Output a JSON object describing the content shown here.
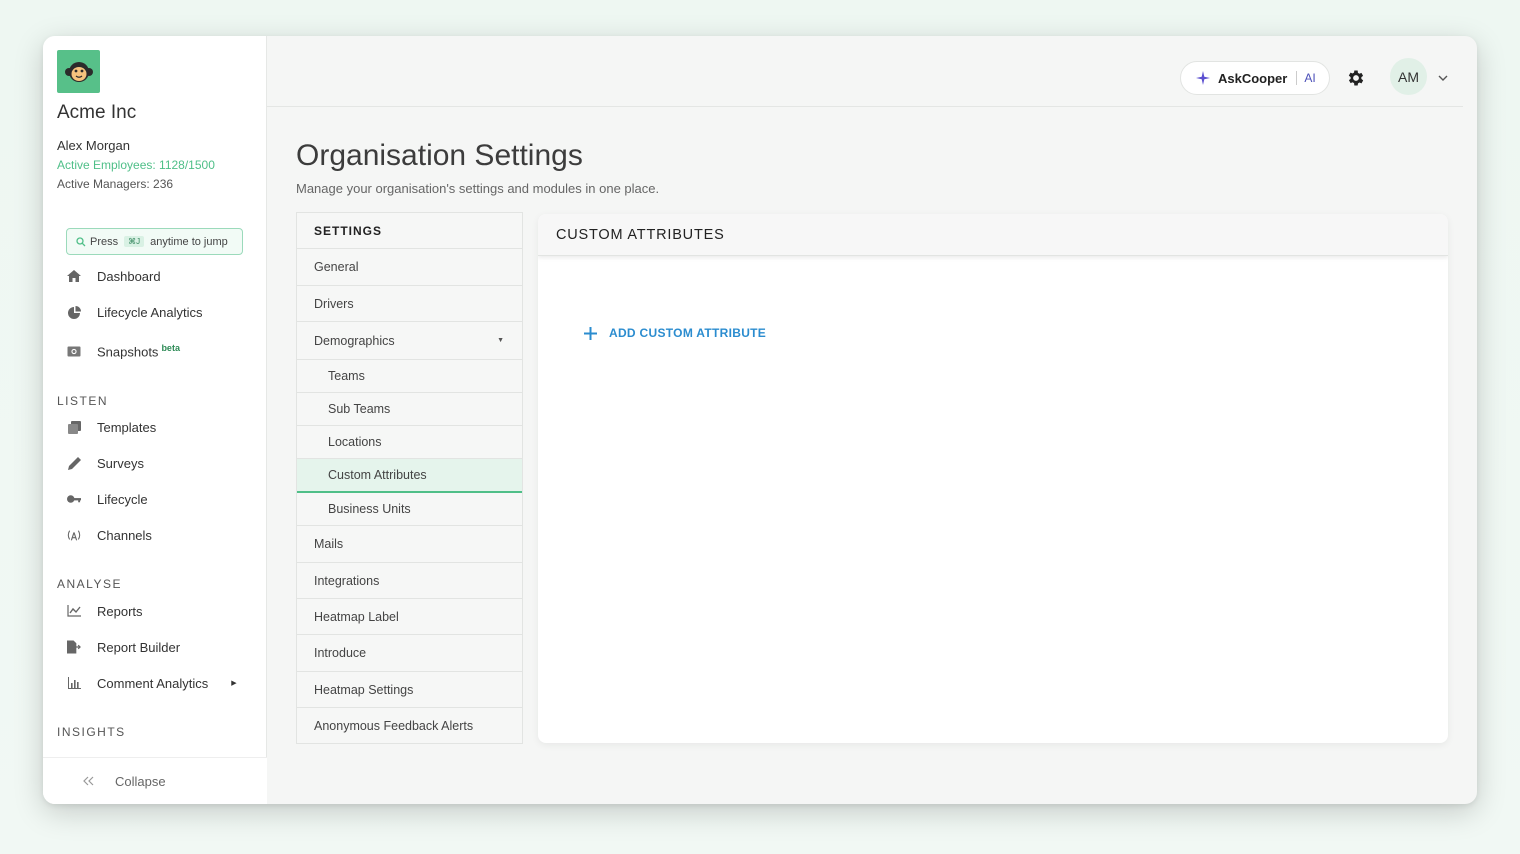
{
  "sidebar": {
    "org_name": "Acme Inc",
    "user_name": "Alex Morgan",
    "active_employees": "Active Employees: 1128/1500",
    "active_managers": "Active Managers: 236",
    "search": {
      "prefix": "Press",
      "shortcut": "⌘J",
      "suffix": "anytime to jump"
    },
    "main_items": [
      {
        "label": "Dashboard",
        "icon": "home-icon"
      },
      {
        "label": "Lifecycle Analytics",
        "icon": "pie-chart-icon"
      },
      {
        "label": "Snapshots",
        "icon": "camera-icon",
        "badge": "beta"
      }
    ],
    "listen_label": "LISTEN",
    "listen_items": [
      {
        "label": "Templates",
        "icon": "copy-icon"
      },
      {
        "label": "Surveys",
        "icon": "pen-icon"
      },
      {
        "label": "Lifecycle",
        "icon": "key-icon"
      },
      {
        "label": "Channels",
        "icon": "broadcast-icon"
      }
    ],
    "analyse_label": "ANALYSE",
    "analyse_items": [
      {
        "label": "Reports",
        "icon": "line-chart-icon"
      },
      {
        "label": "Report Builder",
        "icon": "document-arrow-icon"
      },
      {
        "label": "Comment Analytics",
        "icon": "bar-chart-icon"
      }
    ],
    "insights_label": "INSIGHTS",
    "collapse_label": "Collapse"
  },
  "header": {
    "askcooper": "AskCooper",
    "ai": "AI",
    "avatar_initials": "AM"
  },
  "main": {
    "title": "Organisation Settings",
    "subtitle": "Manage your organisation's settings and modules in one place.",
    "menu_heading": "SETTINGS",
    "menu": {
      "general": "General",
      "drivers": "Drivers",
      "demographics": "Demographics",
      "teams": "Teams",
      "sub_teams": "Sub Teams",
      "locations": "Locations",
      "custom_attributes": "Custom Attributes",
      "business_units": "Business Units",
      "mails": "Mails",
      "integrations": "Integrations",
      "heatmap_label": "Heatmap Label",
      "introduce": "Introduce",
      "heatmap_settings": "Heatmap Settings",
      "anonymous_feedback_alerts": "Anonymous Feedback Alerts"
    },
    "panel_title": "CUSTOM ATTRIBUTES",
    "add_button": "ADD CUSTOM ATTRIBUTE"
  },
  "colors": {
    "accent_green": "#4fbf88",
    "link_blue": "#2b8ccf",
    "ai_purple": "#4b4fb8"
  }
}
